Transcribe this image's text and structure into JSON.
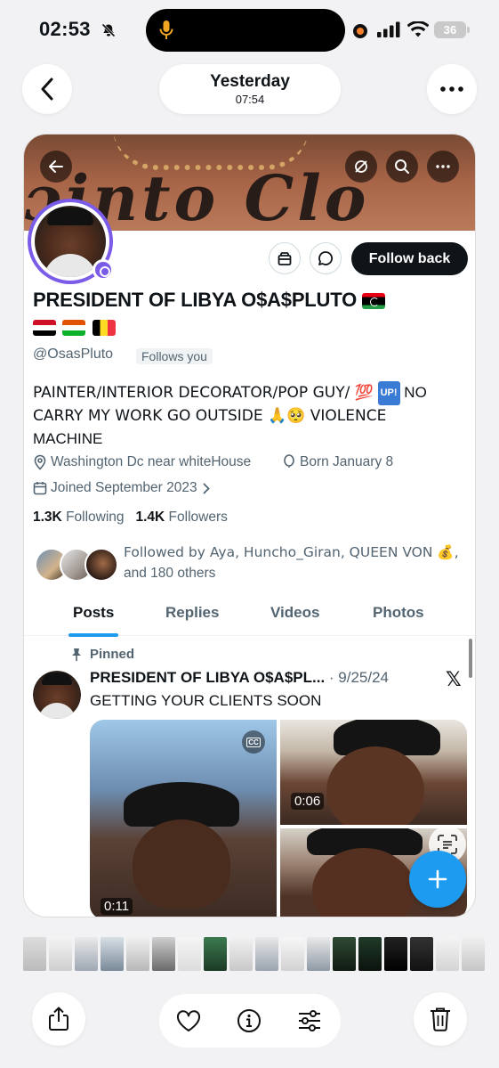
{
  "status_bar": {
    "time": "02:53",
    "battery": "36"
  },
  "header": {
    "date": "Yesterday",
    "time": "07:54"
  },
  "profile": {
    "display_name": "PRESIDENT OF LIBYA O$A$PLUTO",
    "handle": "@OsasPluto",
    "follows_you": "Follows you",
    "follow_back": "Follow back",
    "bio_line1": "PAINTER/INTERIOR DECORATOR/POP GUY/ 💯",
    "bio_up": "UP!",
    "bio_line1_end": " NO",
    "bio_line2": "CARRY MY WORK GO OUTSIDE 🙏🥺 VIOLENCE",
    "bio_line3": "MACHINE",
    "location": "Washington Dc near whiteHouse",
    "birthday": "Born January 8",
    "joined": "Joined September 2023",
    "following_count": "1.3K",
    "following_label": "Following",
    "followers_count": "1.4K",
    "followers_label": "Followers",
    "followed_by_line1": "Followed by Aya, Huncho_Giran, QUEEN VON 💰,",
    "followed_by_line2": "and 180 others"
  },
  "tabs": [
    "Posts",
    "Replies",
    "Videos",
    "Photos"
  ],
  "post": {
    "pinned": "Pinned",
    "author": "PRESIDENT OF LIBYA O$A$PL...",
    "date": " · 9/25/24",
    "text": "GETTING YOUR CLIENTS SOON",
    "durations": [
      "0:11",
      "0:06"
    ]
  },
  "colors": {
    "accent": "#1d9bf0",
    "verified": "#7b5ce8",
    "text": "#0f1419",
    "muted": "#536471"
  }
}
